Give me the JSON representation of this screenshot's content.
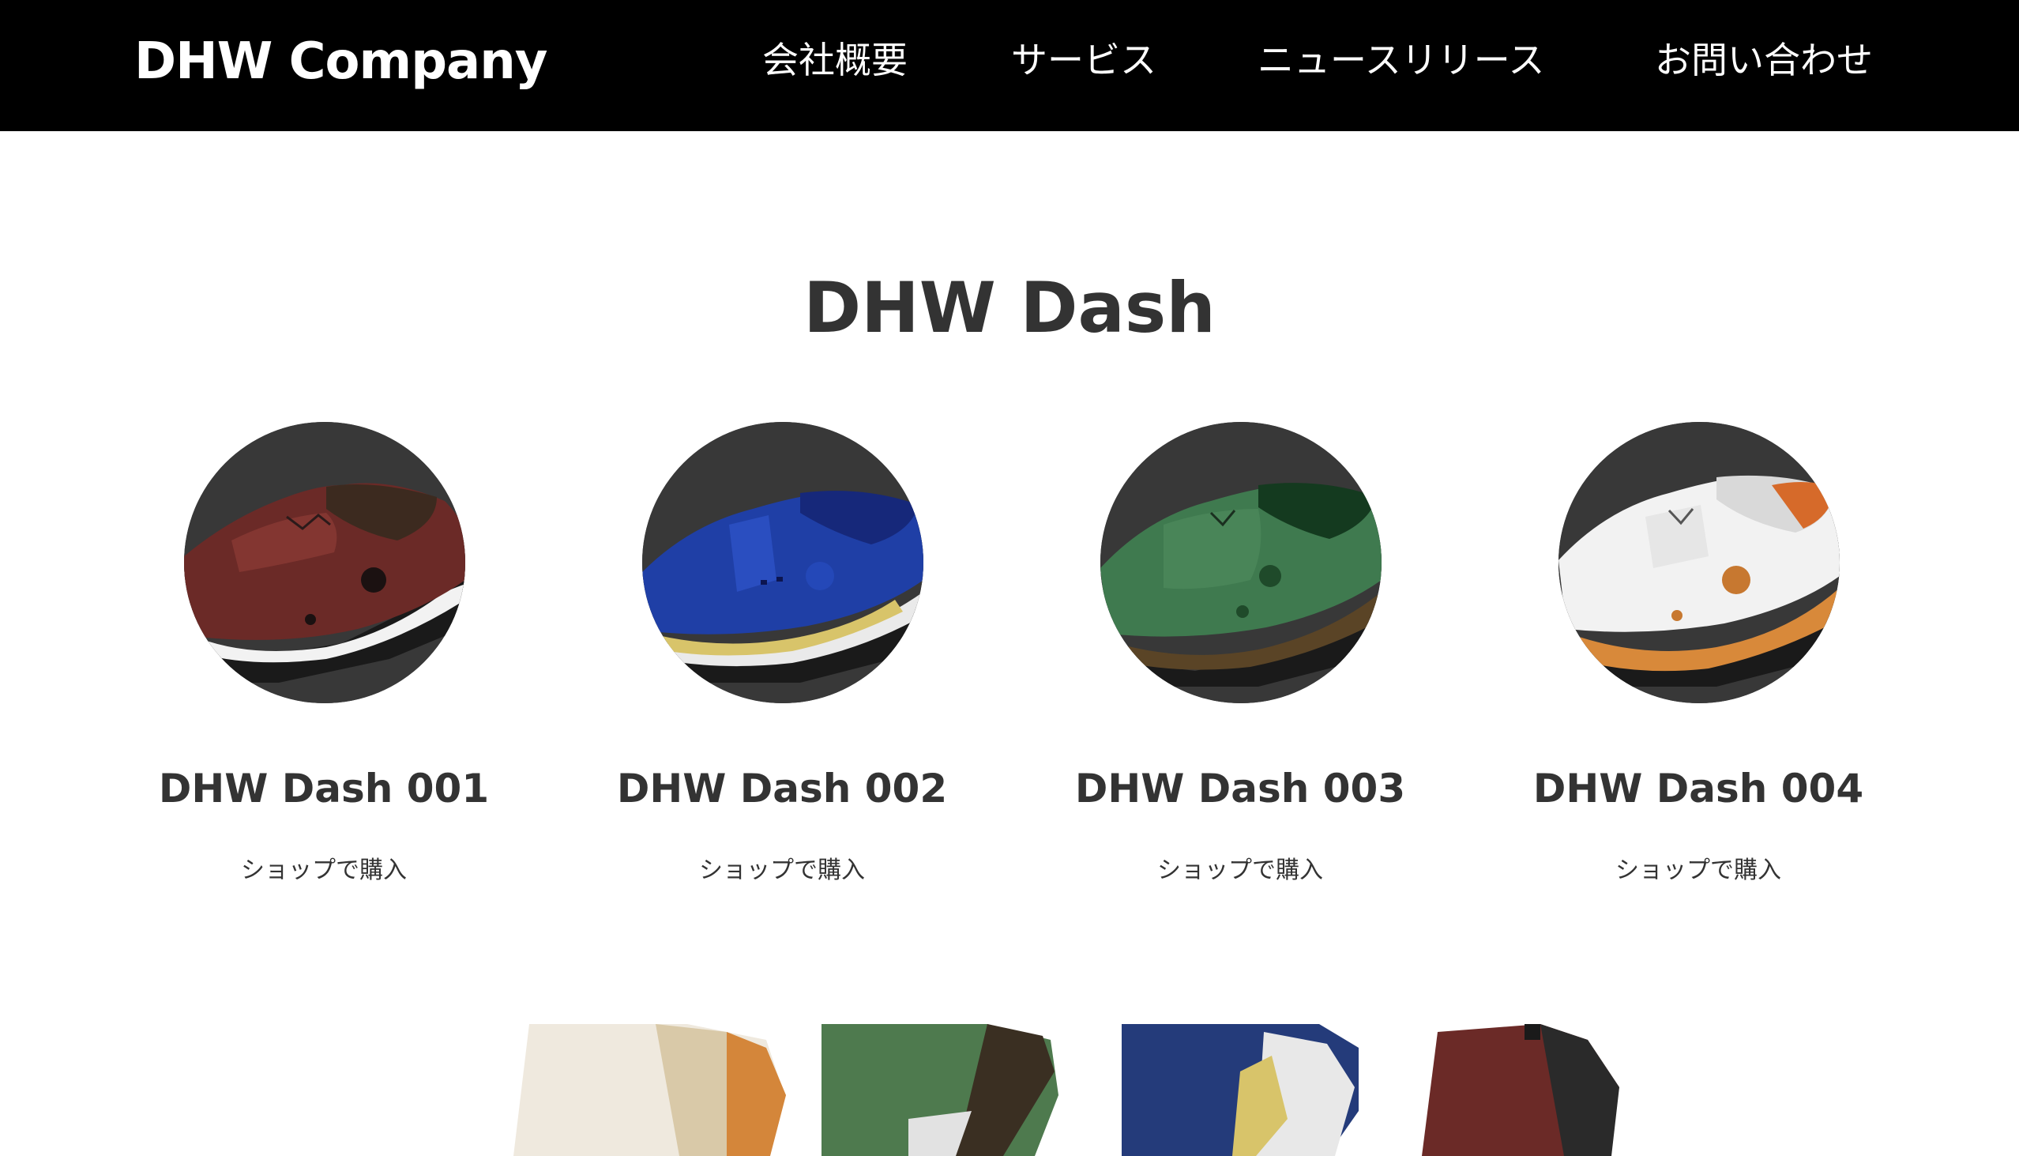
{
  "header": {
    "logo": "DHW Company",
    "nav": [
      {
        "label": "会社概要"
      },
      {
        "label": "サービス"
      },
      {
        "label": "ニュースリリース"
      },
      {
        "label": "お問い合わせ"
      }
    ]
  },
  "section": {
    "title": "DHW Dash"
  },
  "products": [
    {
      "name": "DHW Dash 001",
      "cta": "ショップで購入",
      "color": "#6b2a27"
    },
    {
      "name": "DHW Dash 002",
      "cta": "ショップで購入",
      "color": "#1f3fa6"
    },
    {
      "name": "DHW Dash 003",
      "cta": "ショップで購入",
      "color": "#3f7a4f"
    },
    {
      "name": "DHW Dash 004",
      "cta": "ショップで購入",
      "color": "#f2f2f2"
    }
  ],
  "colors": {
    "header_bg": "#000000",
    "header_text": "#ffffff",
    "body_text": "#333333",
    "circle_bg": "#383838"
  }
}
